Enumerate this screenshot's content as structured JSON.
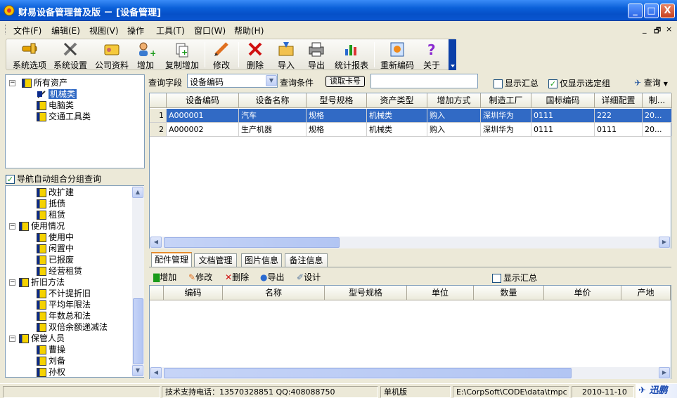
{
  "window": {
    "title": "财易设备管理普及版 － [设备管理]",
    "minimize": "_",
    "maximize": "□",
    "close": "X"
  },
  "menu": [
    "文件(F)",
    "编辑(E)",
    "视图(V)",
    "操作",
    "工具(T)",
    "窗口(W)",
    "帮助(H)"
  ],
  "mdi_controls": {
    "min": "_",
    "restore": "🗗",
    "close": "×"
  },
  "toolbar": [
    {
      "label": "系统选项",
      "icon": "hand-tool-icon"
    },
    {
      "label": "系统设置",
      "icon": "wrench-icon"
    },
    {
      "label": "公司资料",
      "icon": "card-icon"
    },
    {
      "label": "增加",
      "icon": "add-user-icon"
    },
    {
      "label": "复制增加",
      "icon": "copy-add-icon"
    },
    {
      "label": "修改",
      "icon": "pencil-icon"
    },
    {
      "label": "删除",
      "icon": "delete-x-icon"
    },
    {
      "label": "导入",
      "icon": "import-icon"
    },
    {
      "label": "导出",
      "icon": "printer-export-icon"
    },
    {
      "label": "统计报表",
      "icon": "bar-chart-icon"
    },
    {
      "label": "重新编码",
      "icon": "recode-icon"
    },
    {
      "label": "关于",
      "icon": "question-icon"
    }
  ],
  "tree1": {
    "root": "所有资产",
    "children": [
      "机械类",
      "电脑类",
      "交通工具类"
    ]
  },
  "auto_group_label": "导航自动组合分组查询",
  "tree2": [
    {
      "text": "改扩建",
      "level": 2
    },
    {
      "text": "抵债",
      "level": 2
    },
    {
      "text": "租赁",
      "level": 2
    },
    {
      "text": "使用情况",
      "level": 1
    },
    {
      "text": "使用中",
      "level": 2
    },
    {
      "text": "闲置中",
      "level": 2
    },
    {
      "text": "已报废",
      "level": 2
    },
    {
      "text": "经营租赁",
      "level": 2
    },
    {
      "text": "折旧方法",
      "level": 1
    },
    {
      "text": "不计提折旧",
      "level": 2
    },
    {
      "text": "平均年限法",
      "level": 2
    },
    {
      "text": "年数总和法",
      "level": 2
    },
    {
      "text": "双倍余额递减法",
      "level": 2
    },
    {
      "text": "保管人员",
      "level": 1
    },
    {
      "text": "曹操",
      "level": 2
    },
    {
      "text": "刘备",
      "level": 2
    },
    {
      "text": "孙权",
      "level": 2
    }
  ],
  "query": {
    "field_label": "查询字段",
    "field_value": "设备编码",
    "cond_label": "查询条件",
    "read_card": "读取卡号",
    "cond_value": "",
    "show_summary": "显示汇总",
    "only_selected": "仅显示选定组",
    "query_btn": "查询"
  },
  "main_grid": {
    "headers": [
      "设备编码",
      "设备名称",
      "型号规格",
      "资产类型",
      "增加方式",
      "制造工厂",
      "国标编码",
      "详细配置",
      "制..."
    ],
    "rows": [
      {
        "num": "1",
        "cells": [
          "A000001",
          "汽车",
          "规格",
          "机械类",
          "购入",
          "深圳华为",
          "0111",
          "222",
          "20..."
        ]
      },
      {
        "num": "2",
        "cells": [
          "A000002",
          "生产机器",
          "规格",
          "机械类",
          "购入",
          "深圳华为",
          "0111",
          "0111",
          "20..."
        ]
      }
    ]
  },
  "tabs": [
    "配件管理",
    "文档管理",
    "图片信息",
    "备注信息"
  ],
  "sub_toolbar": {
    "add": "增加",
    "edit": "修改",
    "delete": "删除",
    "export": "导出",
    "design": "设计",
    "show_summary": "显示汇总"
  },
  "sub_grid": {
    "headers": [
      "编码",
      "名称",
      "型号规格",
      "单位",
      "数量",
      "单价",
      "产地"
    ]
  },
  "status": {
    "support": "技术支持电话：13570328851 QQ:408088750",
    "mode": "单机版",
    "path": "E:\\CorpSoft\\CODE\\data\\tmpc",
    "date": "2010-11-10",
    "logo": "迅鹏"
  }
}
